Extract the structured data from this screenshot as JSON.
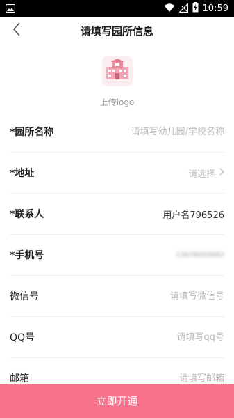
{
  "status_bar": {
    "time": "10:59",
    "icons": [
      "image-icon",
      "wifi-icon",
      "no-signal-icon",
      "battery-charging-icon"
    ]
  },
  "header": {
    "title": "请填写园所信息",
    "back_icon": "chevron-left-icon"
  },
  "logo": {
    "label": "上传logo",
    "icon": "school-building-icon"
  },
  "form": {
    "name": {
      "label": "*园所名称",
      "placeholder": "请填写幼儿园/学校名称"
    },
    "address": {
      "label": "*地址",
      "value": "请选择",
      "icon": "chevron-right-icon"
    },
    "contact": {
      "label": "*联系人",
      "value": "用户名796526"
    },
    "phone": {
      "label": "*手机号",
      "value": "13678459982"
    },
    "wechat": {
      "label": "微信号",
      "placeholder": "请填写微信号"
    },
    "qq": {
      "label": "QQ号",
      "placeholder": "请填写qq号"
    },
    "email": {
      "label": "邮箱",
      "placeholder": "请填写邮箱"
    }
  },
  "submit": {
    "label": "立即开通"
  },
  "colors": {
    "accent": "#f7728a",
    "logo_bg": "#fbeef1",
    "placeholder": "#bbbbbb"
  }
}
